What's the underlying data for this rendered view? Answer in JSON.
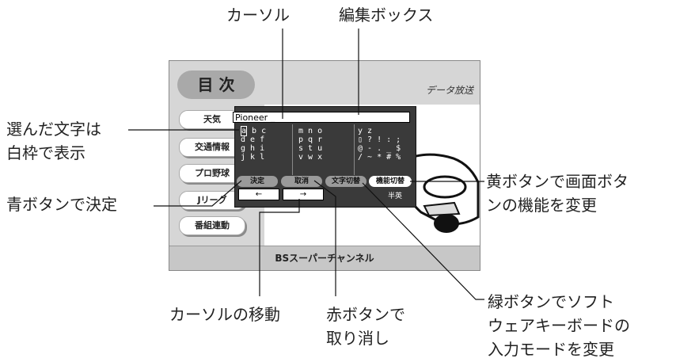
{
  "callouts": {
    "cursor": "カーソル",
    "edit_box": "編集ボックス",
    "selected_char": [
      "選んだ文字は",
      "白枠で表示"
    ],
    "blue_button": "青ボタンで決定",
    "yellow_button": [
      "黄ボタンで画面ボタ",
      "ンの機能を変更"
    ],
    "cursor_move": "カーソルの移動",
    "red_button": [
      "赤ボタンで",
      "取り消し"
    ],
    "green_button": [
      "緑ボタンでソフト",
      "ウェアキーボードの",
      "入力モードを変更"
    ]
  },
  "screen": {
    "title": "目 次",
    "header_right": "データ放送",
    "menu": [
      "天気",
      "交通情報",
      "プロ野球",
      "Jリーグ",
      "番組連動"
    ],
    "footer": "BSスーパーチャンネル"
  },
  "keyboard": {
    "input_text": "Pioneer _",
    "selected_char": "a",
    "col1_rows": [
      " b c",
      "d e f",
      "g h i",
      "j k l"
    ],
    "col2_rows": [
      "m n o",
      "p q r",
      "s t u",
      "v w x"
    ],
    "col3_rows": [
      "y z",
      "▯ ? ! : ;",
      "@ - . _ $",
      "/ ~ * # %"
    ],
    "buttons": {
      "decide": "決定",
      "cancel": "取消",
      "char_switch": "文字切替",
      "func_switch": "機能切替"
    },
    "left_arrow": "←",
    "right_arrow": "→",
    "mode": "半英"
  }
}
